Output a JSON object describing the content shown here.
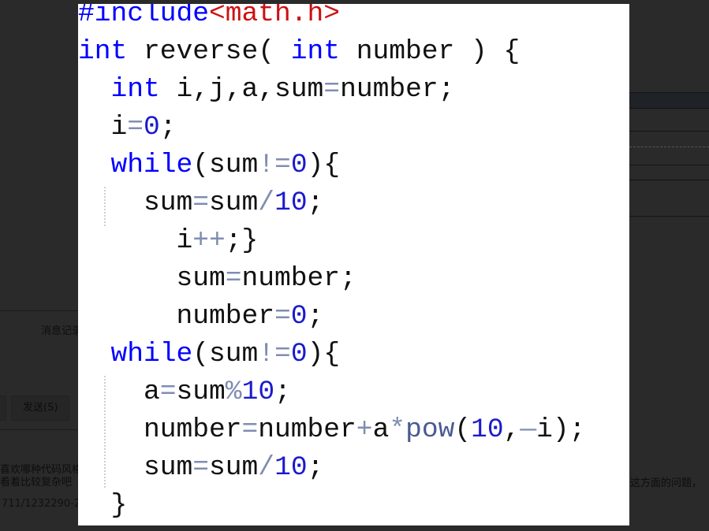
{
  "background": {
    "message_log_label": "消息记录",
    "send_button": "发送(S)",
    "chat_lines": [
      "喜欢哪种代码风格",
      "看着比较复杂吧"
    ],
    "link_fragment": "711/1232290-2",
    "right_fragment": "这方面的问题，"
  },
  "colors": {
    "keyword": "#0000ff",
    "string": "#cc1111",
    "number": "#1a1acc",
    "operator": "#7f8db0",
    "function": "#4a5a90",
    "overlay": "#2a2a2a"
  },
  "code": [
    [
      {
        "t": "#include",
        "c": "k"
      },
      {
        "t": "<math.h>",
        "c": "s"
      }
    ],
    [
      {
        "t": "int",
        "c": "k"
      },
      {
        "t": " reverse( ",
        "c": "p"
      },
      {
        "t": "int",
        "c": "k"
      },
      {
        "t": " number ) {",
        "c": "p"
      }
    ],
    [
      {
        "t": "  ",
        "c": "p"
      },
      {
        "t": "int",
        "c": "k"
      },
      {
        "t": " i,j,a,sum",
        "c": "p"
      },
      {
        "t": "=",
        "c": "o"
      },
      {
        "t": "number;",
        "c": "p"
      }
    ],
    [
      {
        "t": "  i",
        "c": "p"
      },
      {
        "t": "=",
        "c": "o"
      },
      {
        "t": "0",
        "c": "n"
      },
      {
        "t": ";",
        "c": "p"
      }
    ],
    [
      {
        "t": "  ",
        "c": "p"
      },
      {
        "t": "while",
        "c": "k"
      },
      {
        "t": "(sum",
        "c": "p"
      },
      {
        "t": "!=",
        "c": "o"
      },
      {
        "t": "0",
        "c": "n"
      },
      {
        "t": "){",
        "c": "p"
      }
    ],
    [
      {
        "t": "    sum",
        "c": "p"
      },
      {
        "t": "=",
        "c": "o"
      },
      {
        "t": "sum",
        "c": "p"
      },
      {
        "t": "/",
        "c": "o"
      },
      {
        "t": "10",
        "c": "n"
      },
      {
        "t": ";",
        "c": "p"
      }
    ],
    [
      {
        "t": "      i",
        "c": "p"
      },
      {
        "t": "++",
        "c": "o"
      },
      {
        "t": ";}",
        "c": "p"
      }
    ],
    [
      {
        "t": "      sum",
        "c": "p"
      },
      {
        "t": "=",
        "c": "o"
      },
      {
        "t": "number;",
        "c": "p"
      }
    ],
    [
      {
        "t": "      number",
        "c": "p"
      },
      {
        "t": "=",
        "c": "o"
      },
      {
        "t": "0",
        "c": "n"
      },
      {
        "t": ";",
        "c": "p"
      }
    ],
    [
      {
        "t": "  ",
        "c": "p"
      },
      {
        "t": "while",
        "c": "k"
      },
      {
        "t": "(sum",
        "c": "p"
      },
      {
        "t": "!=",
        "c": "o"
      },
      {
        "t": "0",
        "c": "n"
      },
      {
        "t": "){",
        "c": "p"
      }
    ],
    [
      {
        "t": "    a",
        "c": "p"
      },
      {
        "t": "=",
        "c": "o"
      },
      {
        "t": "sum",
        "c": "p"
      },
      {
        "t": "%",
        "c": "o"
      },
      {
        "t": "10",
        "c": "n"
      },
      {
        "t": ";",
        "c": "p"
      }
    ],
    [
      {
        "t": "    number",
        "c": "p"
      },
      {
        "t": "=",
        "c": "o"
      },
      {
        "t": "number",
        "c": "p"
      },
      {
        "t": "+",
        "c": "o"
      },
      {
        "t": "a",
        "c": "p"
      },
      {
        "t": "*",
        "c": "o"
      },
      {
        "t": "pow",
        "c": "f"
      },
      {
        "t": "(",
        "c": "p"
      },
      {
        "t": "10",
        "c": "n"
      },
      {
        "t": ",",
        "c": "p"
      },
      {
        "t": "—",
        "c": "o"
      },
      {
        "t": "i);",
        "c": "p"
      }
    ],
    [
      {
        "t": "    sum",
        "c": "p"
      },
      {
        "t": "=",
        "c": "o"
      },
      {
        "t": "sum",
        "c": "p"
      },
      {
        "t": "/",
        "c": "o"
      },
      {
        "t": "10",
        "c": "n"
      },
      {
        "t": ";",
        "c": "p"
      }
    ],
    [
      {
        "t": "  }",
        "c": "p"
      }
    ]
  ]
}
